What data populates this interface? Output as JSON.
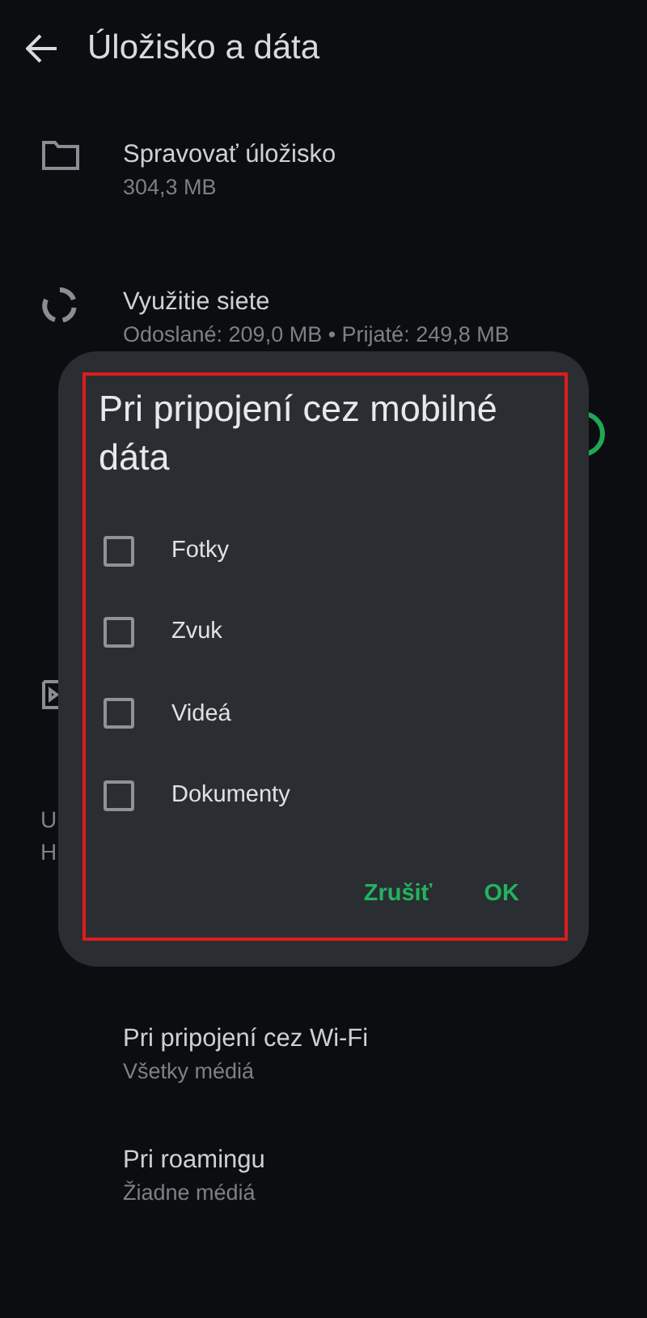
{
  "header": {
    "title": "Úložisko a dáta"
  },
  "settings": [
    {
      "title": "Spravovať úložisko",
      "subtitle": "304,3 MB"
    },
    {
      "title": "Využitie siete",
      "subtitle": "Odoslané: 209,0 MB • Prijaté: 249,8 MB"
    }
  ],
  "hidden_toggle": {
    "on": true
  },
  "hidden_fragments": [
    "U",
    "H"
  ],
  "media_rows": [
    {
      "title": "Pri pripojení cez Wi-Fi",
      "subtitle": "Všetky médiá"
    },
    {
      "title": "Pri roamingu",
      "subtitle": "Žiadne médiá"
    }
  ],
  "dialog": {
    "title": "Pri pripojení cez mobilné dáta",
    "options": [
      {
        "label": "Fotky",
        "checked": false
      },
      {
        "label": "Zvuk",
        "checked": false
      },
      {
        "label": "Videá",
        "checked": false
      },
      {
        "label": "Dokumenty",
        "checked": false
      }
    ],
    "buttons": [
      "Zrušiť",
      "OK"
    ]
  }
}
